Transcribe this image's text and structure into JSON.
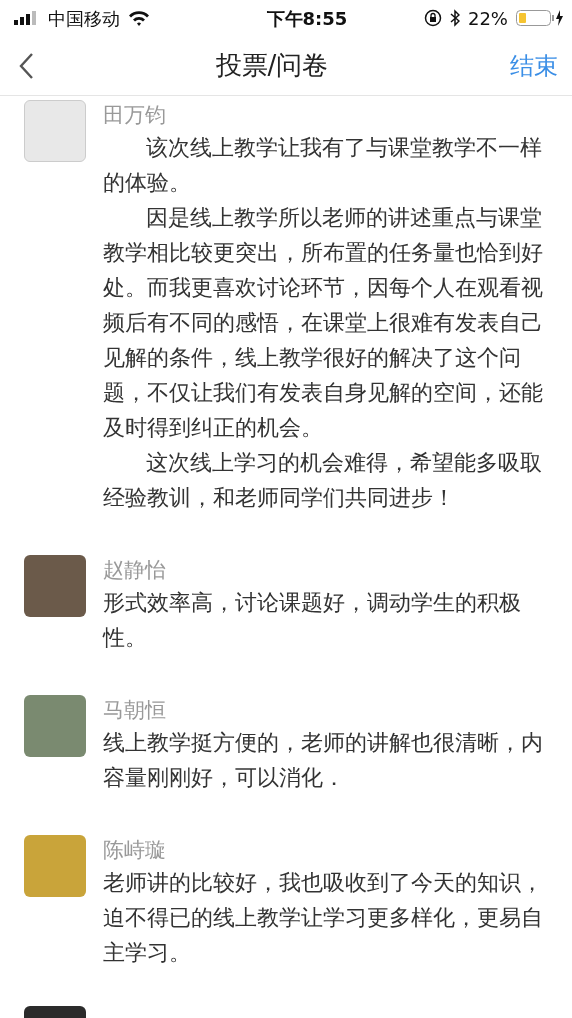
{
  "status_bar": {
    "carrier": "中国移动",
    "time": "下午8:55",
    "battery": "22%"
  },
  "nav": {
    "title": "投票/问卷",
    "action": "结束"
  },
  "comments": [
    {
      "name": "田万钧",
      "paragraphs": [
        "该次线上教学让我有了与课堂教学不一样的体验。",
        "因是线上教学所以老师的讲述重点与课堂教学相比较更突出，所布置的任务量也恰到好处。而我更喜欢讨论环节，因每个人在观看视频后有不同的感悟，在课堂上很难有发表自己见解的条件，线上教学很好的解决了这个问题，不仅让我们有发表自身见解的空间，还能及时得到纠正的机会。",
        "这次线上学习的机会难得，希望能多吸取经验教训，和老师同学们共同进步！"
      ]
    },
    {
      "name": "赵静怡",
      "paragraphs": [
        "形式效率高，讨论课题好，调动学生的积极性。"
      ]
    },
    {
      "name": "马朝恒",
      "paragraphs": [
        "线上教学挺方便的，老师的讲解也很清晰，内容量刚刚好，可以消化．"
      ]
    },
    {
      "name": "陈峙璇",
      "paragraphs": [
        "老师讲的比较好，我也吸收到了今天的知识，迫不得已的线上教学让学习更多样化，更易自主学习。"
      ]
    }
  ]
}
